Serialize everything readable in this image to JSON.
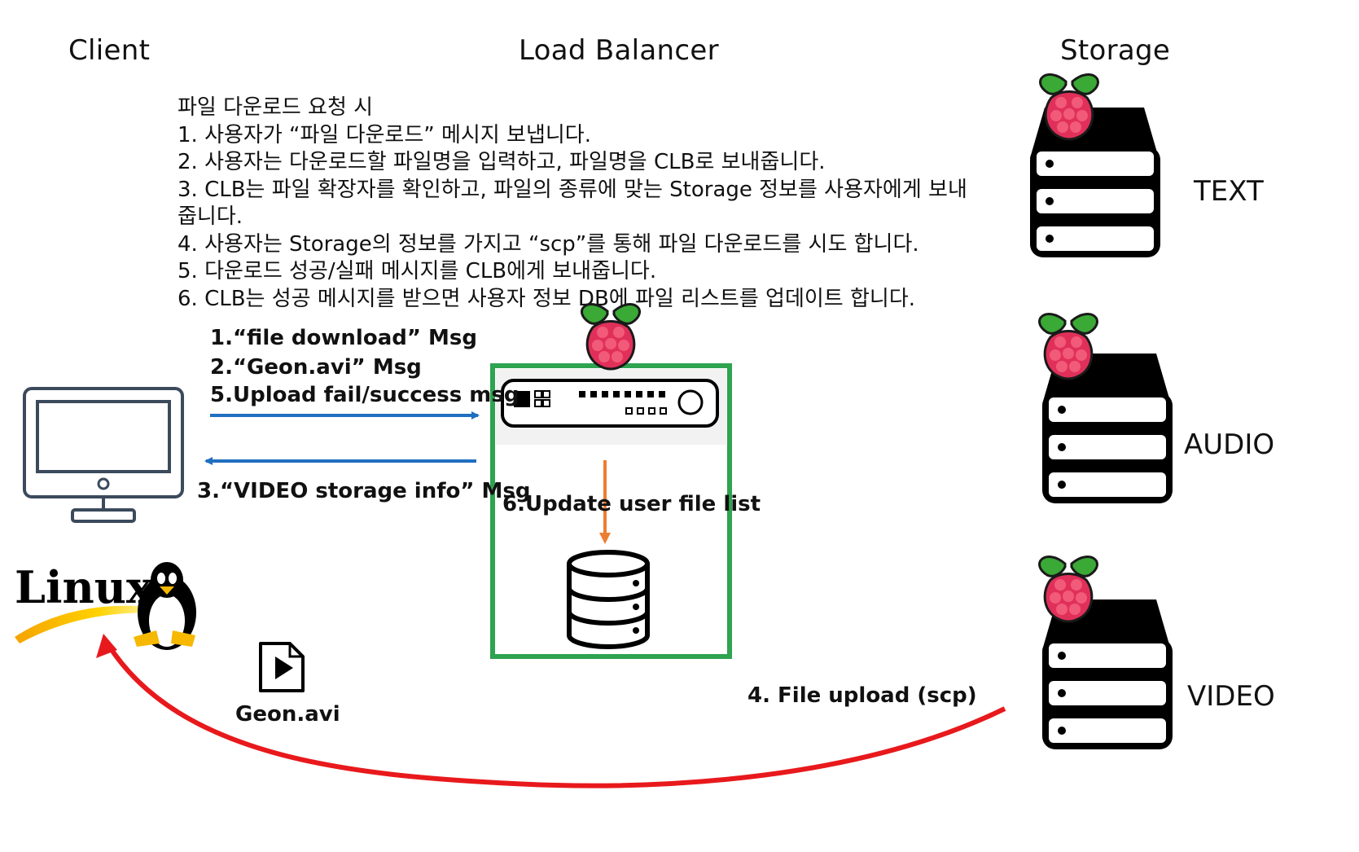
{
  "columns": {
    "client": "Client",
    "load_balancer": "Load Balancer",
    "storage": "Storage"
  },
  "instructions": {
    "heading": "파일 다운로드 요청 시",
    "steps": [
      "1. 사용자가 “파일 다운로드” 메시지 보냅니다.",
      "2. 사용자는 다운로드할 파일명을 입력하고, 파일명을 CLB로 보내줍니다.",
      "3. CLB는 파일 확장자를 확인하고, 파일의 종류에 맞는 Storage 정보를 사용자에게 보내줍니다.",
      "4. 사용자는 Storage의 정보를 가지고 “scp”를 통해 파일 다운로드를 시도 합니다.",
      "5. 다운로드 성공/실패 메시지를 CLB에게 보내줍니다.",
      "6. CLB는 성공 메시지를 받으면 사용자 정보 DB에 파일 리스트를 업데이트 합니다."
    ]
  },
  "messages": {
    "msg1": "1.“file download” Msg",
    "msg2": "2.“Geon.avi” Msg",
    "msg5": "5.Upload fail/success msg",
    "msg3": "3.“VIDEO storage info” Msg",
    "msg6": "6.Update user file list",
    "msg4": "4. File upload (scp)"
  },
  "file": {
    "name": "Geon.avi",
    "icon": "video-file-icon"
  },
  "logo": {
    "text": "Linux",
    "icon": "tux-penguin-icon"
  },
  "storage_nodes": [
    {
      "label": "TEXT",
      "icon": "server-stack-icon"
    },
    {
      "label": "AUDIO",
      "icon": "server-stack-icon"
    },
    {
      "label": "VIDEO",
      "icon": "server-stack-icon"
    }
  ],
  "colors": {
    "flow_arrow": "#1f6fc0",
    "update_arrow": "#ed7d31",
    "upload_arrow": "#e8191c",
    "lb_border": "#2ea350",
    "client_monitor": "#3b4a5c",
    "raspberry": "#e0305a",
    "leaf": "#3aa936"
  }
}
